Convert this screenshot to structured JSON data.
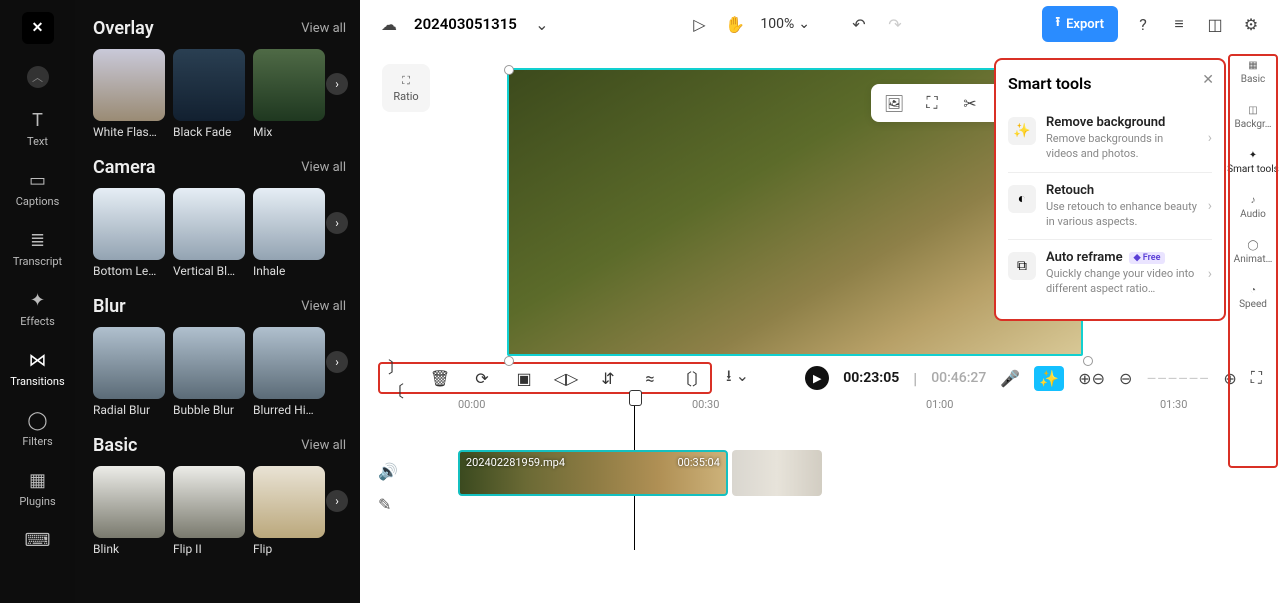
{
  "leftRail": [
    {
      "label": "Text"
    },
    {
      "label": "Captions"
    },
    {
      "label": "Transcript"
    },
    {
      "label": "Effects"
    },
    {
      "label": "Transitions"
    },
    {
      "label": "Filters"
    },
    {
      "label": "Plugins"
    }
  ],
  "panel": {
    "sections": [
      {
        "title": "Overlay",
        "viewAll": "View all",
        "items": [
          "White Flas…",
          "Black Fade",
          "Mix"
        ]
      },
      {
        "title": "Camera",
        "viewAll": "View all",
        "items": [
          "Bottom Le…",
          "Vertical Bl…",
          "Inhale"
        ]
      },
      {
        "title": "Blur",
        "viewAll": "View all",
        "items": [
          "Radial Blur",
          "Bubble Blur",
          "Blurred Hi…"
        ]
      },
      {
        "title": "Basic",
        "viewAll": "View all",
        "items": [
          "Blink",
          "Flip II",
          "Flip"
        ]
      }
    ]
  },
  "top": {
    "projectTitle": "202403051315",
    "zoom": "100%",
    "export": "Export",
    "ratio": "Ratio"
  },
  "smartTools": {
    "title": "Smart tools",
    "items": [
      {
        "title": "Remove background",
        "desc": "Remove backgrounds in videos and photos."
      },
      {
        "title": "Retouch",
        "desc": "Use retouch to enhance beauty in various aspects."
      },
      {
        "title": "Auto reframe",
        "desc": "Quickly change your video into different aspect ratio…",
        "badge": "Free"
      }
    ]
  },
  "rightRail": [
    "Basic",
    "Backgr…",
    "Smart tools",
    "Audio",
    "Animat…",
    "Speed"
  ],
  "playback": {
    "current": "00:23:05",
    "total": "00:46:27"
  },
  "ruler": [
    "00:00",
    "00:30",
    "01:00",
    "01:30"
  ],
  "clip": {
    "name": "202402281959.mp4",
    "dur": "00:35:04"
  }
}
